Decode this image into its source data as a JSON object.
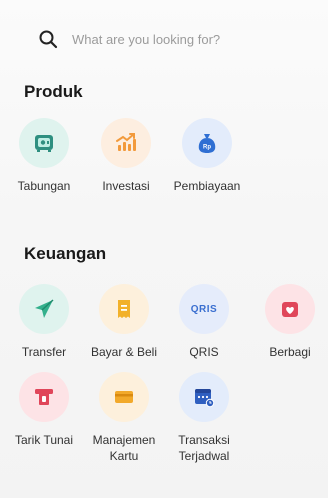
{
  "search": {
    "placeholder": "What are you looking for?"
  },
  "produk": {
    "title": "Produk",
    "items": [
      {
        "label": "Tabungan",
        "icon": "safe-icon",
        "bg": "#dff3ee",
        "fg": "#2e8f80"
      },
      {
        "label": "Investasi",
        "icon": "chart-up-icon",
        "bg": "#fdeee0",
        "fg": "#f29a3c"
      },
      {
        "label": "Pembiayaan",
        "icon": "money-bag-icon",
        "bg": "#e3ecfb",
        "fg": "#2f6fd3"
      }
    ]
  },
  "keuangan": {
    "title": "Keuangan",
    "items": [
      {
        "label": "Transfer",
        "icon": "paper-plane-icon",
        "bg": "#dff3ee",
        "fg": "#33b08c"
      },
      {
        "label": "Bayar & Beli",
        "icon": "receipt-icon",
        "bg": "#fdf0dc",
        "fg": "#f2b12a"
      },
      {
        "label": "QRIS",
        "icon": "qris-icon",
        "bg": "#e5ecfb",
        "fg": "#3a6fd0",
        "text": "QRIS"
      },
      {
        "label": "Berbagi",
        "icon": "gift-heart-icon",
        "bg": "#fde3e6",
        "fg": "#e0465a"
      },
      {
        "label": "Tarik Tunai",
        "icon": "atm-cash-icon",
        "bg": "#fde3e6",
        "fg": "#e0465a"
      },
      {
        "label": "Manajemen\nKartu",
        "icon": "card-icon",
        "bg": "#fdf0dc",
        "fg": "#f2a92a"
      },
      {
        "label": "Transaksi\nTerjadwal",
        "icon": "calendar-clock-icon",
        "bg": "#e3ecfb",
        "fg": "#2f5fc0"
      }
    ]
  }
}
